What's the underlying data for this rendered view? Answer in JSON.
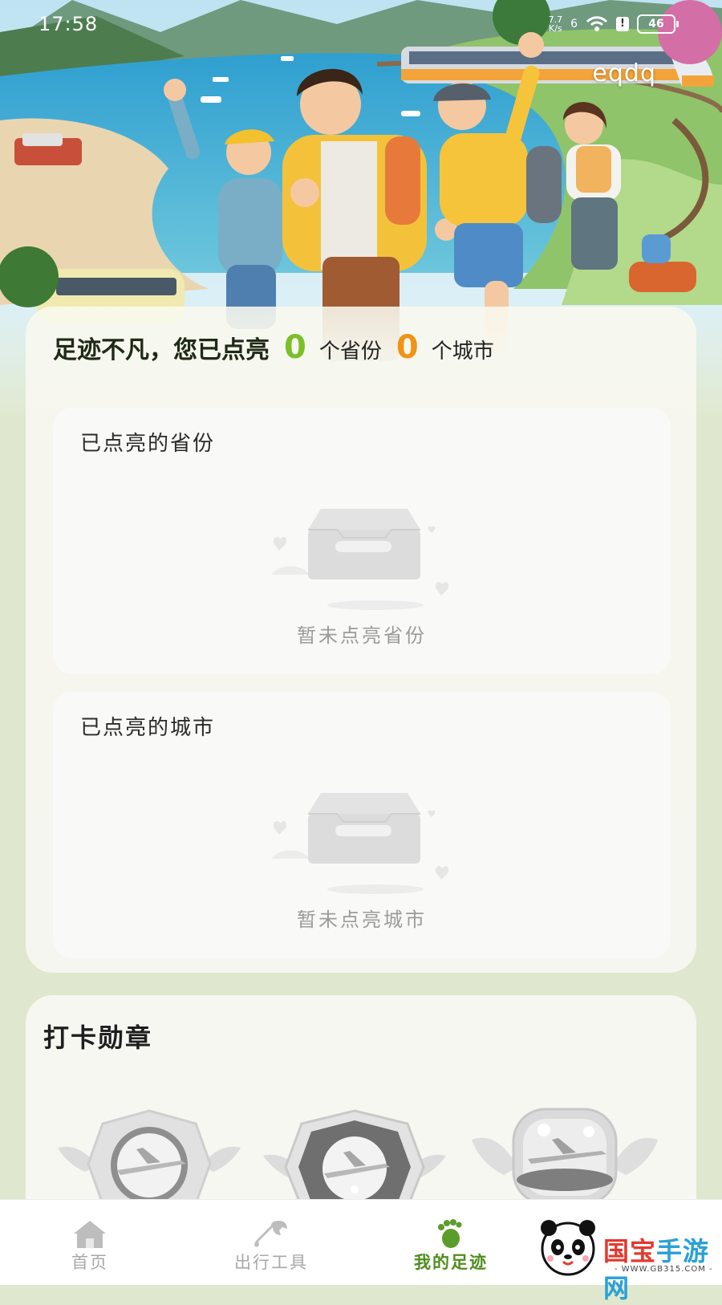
{
  "status_bar": {
    "time": "17:58",
    "net_speed_value": "7.7",
    "net_speed_unit": "K/s",
    "signal_label": "6",
    "battery": "46"
  },
  "header": {
    "username": "eqdq"
  },
  "summary": {
    "lead": "足迹不凡，您已点亮",
    "province_count": "0",
    "province_unit": "个省份",
    "city_count": "0",
    "city_unit": "个城市"
  },
  "provinces_section": {
    "title": "已点亮的省份",
    "empty_text": "暂未点亮省份"
  },
  "cities_section": {
    "title": "已点亮的城市",
    "empty_text": "暂未点亮城市"
  },
  "badges_section": {
    "title": "打卡勋章",
    "badges": [
      {
        "icon": "airplane-badge-icon",
        "state": "locked"
      },
      {
        "icon": "airplane-badge-icon",
        "state": "locked"
      },
      {
        "icon": "airplane-badge-icon",
        "state": "locked"
      }
    ]
  },
  "bottom_nav": {
    "items": [
      {
        "label": "首页",
        "icon": "home-icon",
        "active": false
      },
      {
        "label": "出行工具",
        "icon": "wrench-icon",
        "active": false
      },
      {
        "label": "我的足迹",
        "icon": "footprint-icon",
        "active": true
      }
    ]
  },
  "watermark": {
    "brand_part1": "国宝",
    "brand_part2": "手游网",
    "url": "- WWW.GB315.COM -"
  },
  "colors": {
    "accent_green": "#7cbf29",
    "accent_orange": "#f09416",
    "nav_active": "#4f8d1d",
    "nav_inactive": "#a8a8a8"
  }
}
